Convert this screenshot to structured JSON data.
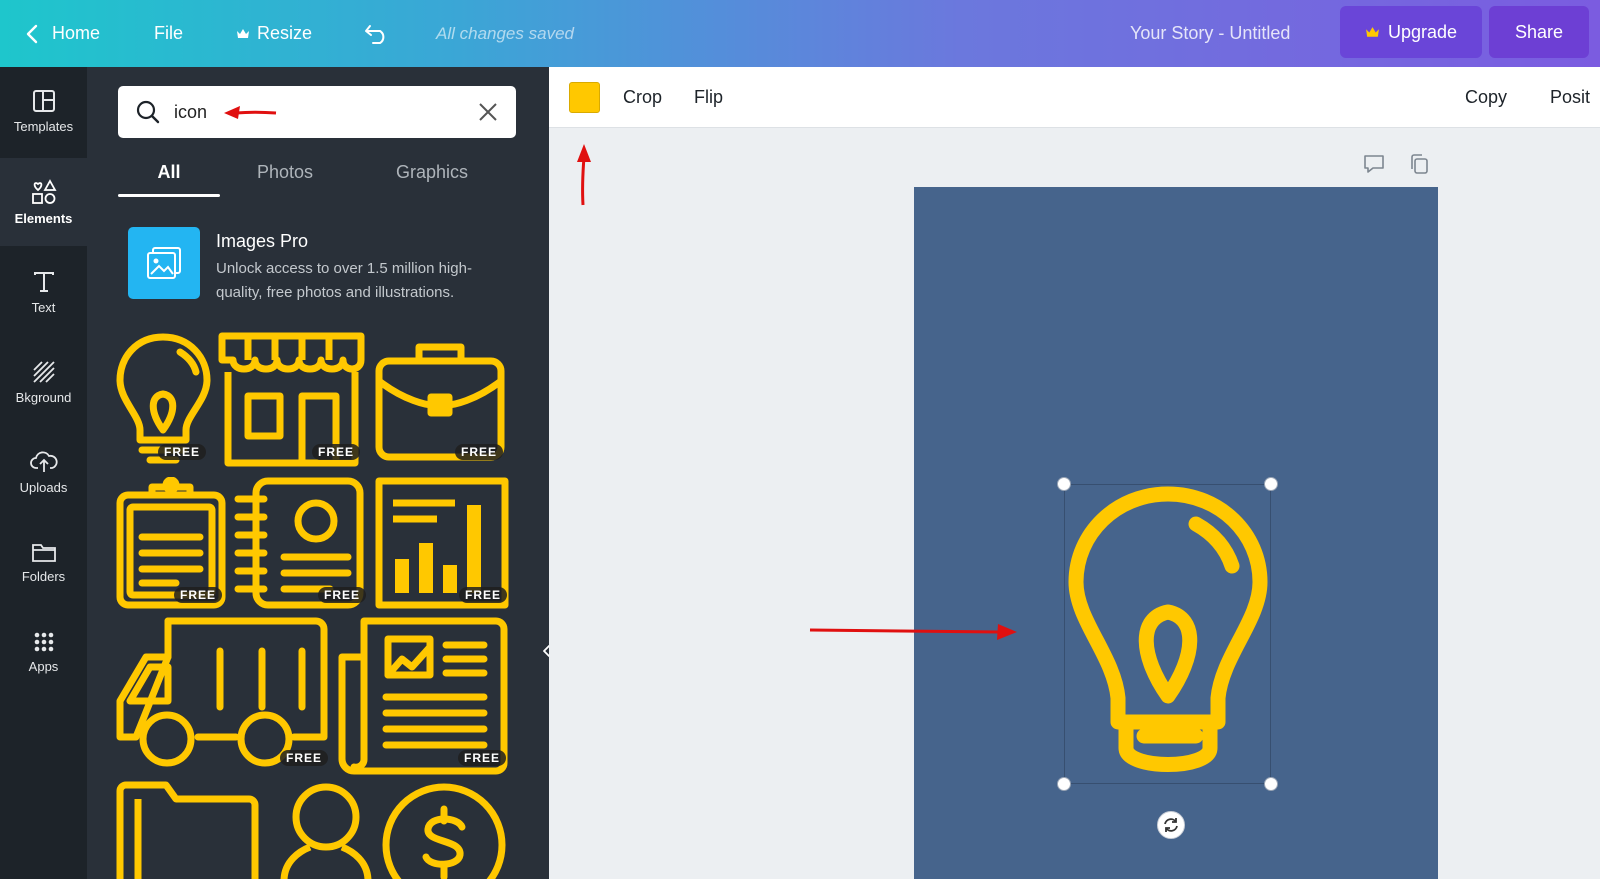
{
  "topbar": {
    "home_label": "Home",
    "file_label": "File",
    "resize_label": "Resize",
    "save_status": "All changes saved",
    "doc_title": "Your Story - Untitled",
    "upgrade_label": "Upgrade",
    "share_label": "Share",
    "icons": {
      "home": "chevron-left-icon",
      "resize": "crown-icon",
      "undo": "undo-icon",
      "upgrade": "crown-icon"
    }
  },
  "sidebar": {
    "items": [
      {
        "label": "Templates",
        "icon": "templates-icon"
      },
      {
        "label": "Elements",
        "icon": "elements-icon",
        "active": true
      },
      {
        "label": "Text",
        "icon": "text-icon"
      },
      {
        "label": "Bkground",
        "icon": "background-icon"
      },
      {
        "label": "Uploads",
        "icon": "upload-cloud-icon"
      },
      {
        "label": "Folders",
        "icon": "folder-icon"
      },
      {
        "label": "Apps",
        "icon": "apps-grid-icon"
      }
    ]
  },
  "panel": {
    "search": {
      "value": "icon"
    },
    "tabs": [
      {
        "label": "All",
        "active": true
      },
      {
        "label": "Photos"
      },
      {
        "label": "Graphics"
      }
    ],
    "promo": {
      "title": "Images Pro",
      "description": "Unlock access to over 1.5 million high-quality, free photos and illustrations."
    },
    "free_badge": "FREE",
    "tiles": [
      "lightbulb-icon",
      "storefront-icon",
      "briefcase-icon",
      "clipboard-icon",
      "notebook-contact-icon",
      "bar-chart-icon",
      "delivery-truck-icon",
      "newspaper-icon",
      "folder-icon",
      "user-icon",
      "dollar-coin-icon"
    ]
  },
  "context_toolbar": {
    "swatch_color": "#ffc800",
    "crop_label": "Crop",
    "flip_label": "Flip",
    "copy_label": "Copy",
    "position_label": "Posit"
  },
  "canvas": {
    "page_color": "#46648c",
    "element_icon": "lightbulb-icon",
    "element_color": "#ffc800"
  },
  "colors": {
    "accent": "#7b5ce0",
    "panel_bg": "#293039",
    "nav_bg": "#1d2329",
    "icon_yellow": "#ffc800",
    "annotation_red": "#e01010"
  }
}
